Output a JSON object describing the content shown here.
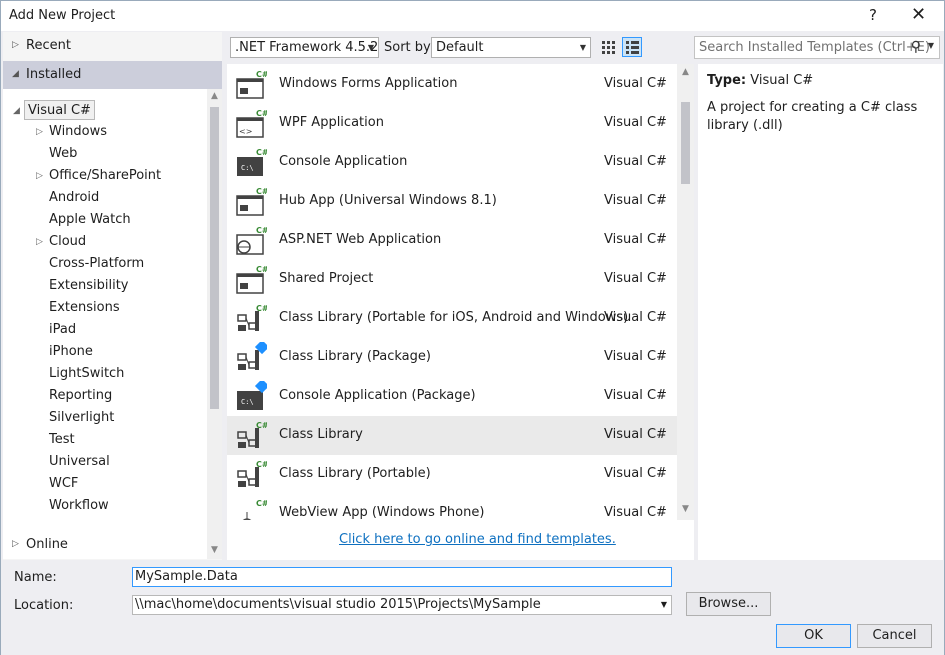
{
  "window": {
    "title": "Add New Project",
    "help": "?",
    "close": "✕"
  },
  "left": {
    "recent": "Recent",
    "installed": "Installed",
    "online": "Online",
    "tree": [
      {
        "label": "Visual C#",
        "expandable": true,
        "expanded": true,
        "selected": true,
        "level": 0
      },
      {
        "label": "Windows",
        "expandable": true,
        "level": 1
      },
      {
        "label": "Web",
        "expandable": false,
        "level": 1
      },
      {
        "label": "Office/SharePoint",
        "expandable": true,
        "level": 1
      },
      {
        "label": "Android",
        "expandable": false,
        "level": 1
      },
      {
        "label": "Apple Watch",
        "expandable": false,
        "level": 1
      },
      {
        "label": "Cloud",
        "expandable": true,
        "level": 1
      },
      {
        "label": "Cross-Platform",
        "expandable": false,
        "level": 1
      },
      {
        "label": "Extensibility",
        "expandable": false,
        "level": 1
      },
      {
        "label": "Extensions",
        "expandable": false,
        "level": 1
      },
      {
        "label": "iPad",
        "expandable": false,
        "level": 1
      },
      {
        "label": "iPhone",
        "expandable": false,
        "level": 1
      },
      {
        "label": "LightSwitch",
        "expandable": false,
        "level": 1
      },
      {
        "label": "Reporting",
        "expandable": false,
        "level": 1
      },
      {
        "label": "Silverlight",
        "expandable": false,
        "level": 1
      },
      {
        "label": "Test",
        "expandable": false,
        "level": 1
      },
      {
        "label": "Universal",
        "expandable": false,
        "level": 1
      },
      {
        "label": "WCF",
        "expandable": false,
        "level": 1
      },
      {
        "label": "Workflow",
        "expandable": false,
        "level": 1
      }
    ]
  },
  "toolbar": {
    "framework": ".NET Framework 4.5.2",
    "sort_label": "Sort by:",
    "sort_value": "Default",
    "search_placeholder": "Search Installed Templates (Ctrl+E)"
  },
  "templates": [
    {
      "name": "Windows Forms Application",
      "lang": "Visual C#",
      "icon": "windows-form-icon"
    },
    {
      "name": "WPF Application",
      "lang": "Visual C#",
      "icon": "wpf-icon"
    },
    {
      "name": "Console Application",
      "lang": "Visual C#",
      "icon": "console-icon"
    },
    {
      "name": "Hub App (Universal Windows 8.1)",
      "lang": "Visual C#",
      "icon": "hub-app-icon"
    },
    {
      "name": "ASP.NET Web Application",
      "lang": "Visual C#",
      "icon": "web-app-icon"
    },
    {
      "name": "Shared Project",
      "lang": "Visual C#",
      "icon": "shared-project-icon"
    },
    {
      "name": "Class Library (Portable for iOS, Android and Windows)",
      "lang": "Visual C#",
      "icon": "class-library-icon"
    },
    {
      "name": "Class Library (Package)",
      "lang": "Visual C#",
      "icon": "class-library-package-icon"
    },
    {
      "name": "Console Application (Package)",
      "lang": "Visual C#",
      "icon": "console-package-icon"
    },
    {
      "name": "Class Library",
      "lang": "Visual C#",
      "icon": "class-library-icon",
      "selected": true
    },
    {
      "name": "Class Library (Portable)",
      "lang": "Visual C#",
      "icon": "class-library-icon"
    },
    {
      "name": "WebView App (Windows Phone)",
      "lang": "Visual C#",
      "icon": "webview-icon"
    }
  ],
  "online_link": "Click here to go online and find templates.",
  "description": {
    "type_label": "Type:",
    "type_value": "Visual C#",
    "text": "A project for creating a C# class library (.dll)"
  },
  "form": {
    "name_label": "Name:",
    "name_value": "MySample.Data",
    "location_label": "Location:",
    "location_value": "\\\\mac\\home\\documents\\visual studio 2015\\Projects\\MySample",
    "browse": "Browse...",
    "ok": "OK",
    "cancel": "Cancel"
  },
  "colors": {
    "accent": "#3399ff",
    "link": "#0e70c0",
    "csharp": "#388a34"
  }
}
